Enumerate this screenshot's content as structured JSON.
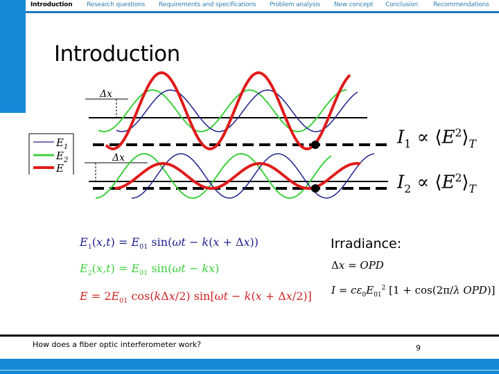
{
  "nav": {
    "items": [
      {
        "label": "Introduction",
        "active": true
      },
      {
        "label": "Research questions",
        "active": false
      },
      {
        "label": "Requirements and specifications",
        "active": false
      },
      {
        "label": "Problem analysis",
        "active": false
      },
      {
        "label": "New concept",
        "active": false
      },
      {
        "label": "Conclusion",
        "active": false
      },
      {
        "label": "Recommendations",
        "active": false
      }
    ]
  },
  "slide": {
    "title": "Introduction",
    "legend": {
      "items": [
        {
          "label": "E1",
          "color": "#1d1d8c"
        },
        {
          "label": "E2",
          "color": "#3ccf3c"
        },
        {
          "label": "E",
          "color": "#e01a1a"
        }
      ]
    },
    "diagram": {
      "delta_label": "Δx",
      "intensity1": "I₁ ∝ ⟨E²⟩T",
      "intensity2": "I₂ ∝ ⟨E²⟩T"
    },
    "equations": {
      "e1": "E₁(x,t) = E₀₁ sin(ωt − k(x + Δx))",
      "e2": "E₂(x,t) = E₀₁ sin(ωt − kx)",
      "e": "E = 2E₀₁ cos(kΔx/2) sin[ωt − k(x + Δx/2)]"
    },
    "irradiance": {
      "label": "Irradiance:",
      "opd": "Δx = OPD",
      "formula": "I = cε₀E₀₁² [1 + cos(2π/λ · OPD)]"
    }
  },
  "footer": {
    "text": "How does a fiber optic interferometer work?",
    "page": "9"
  },
  "colors": {
    "accent": "#1689d6",
    "e1": "#1d1d8c",
    "e2": "#3ccf3c",
    "e": "#e01a1a"
  }
}
